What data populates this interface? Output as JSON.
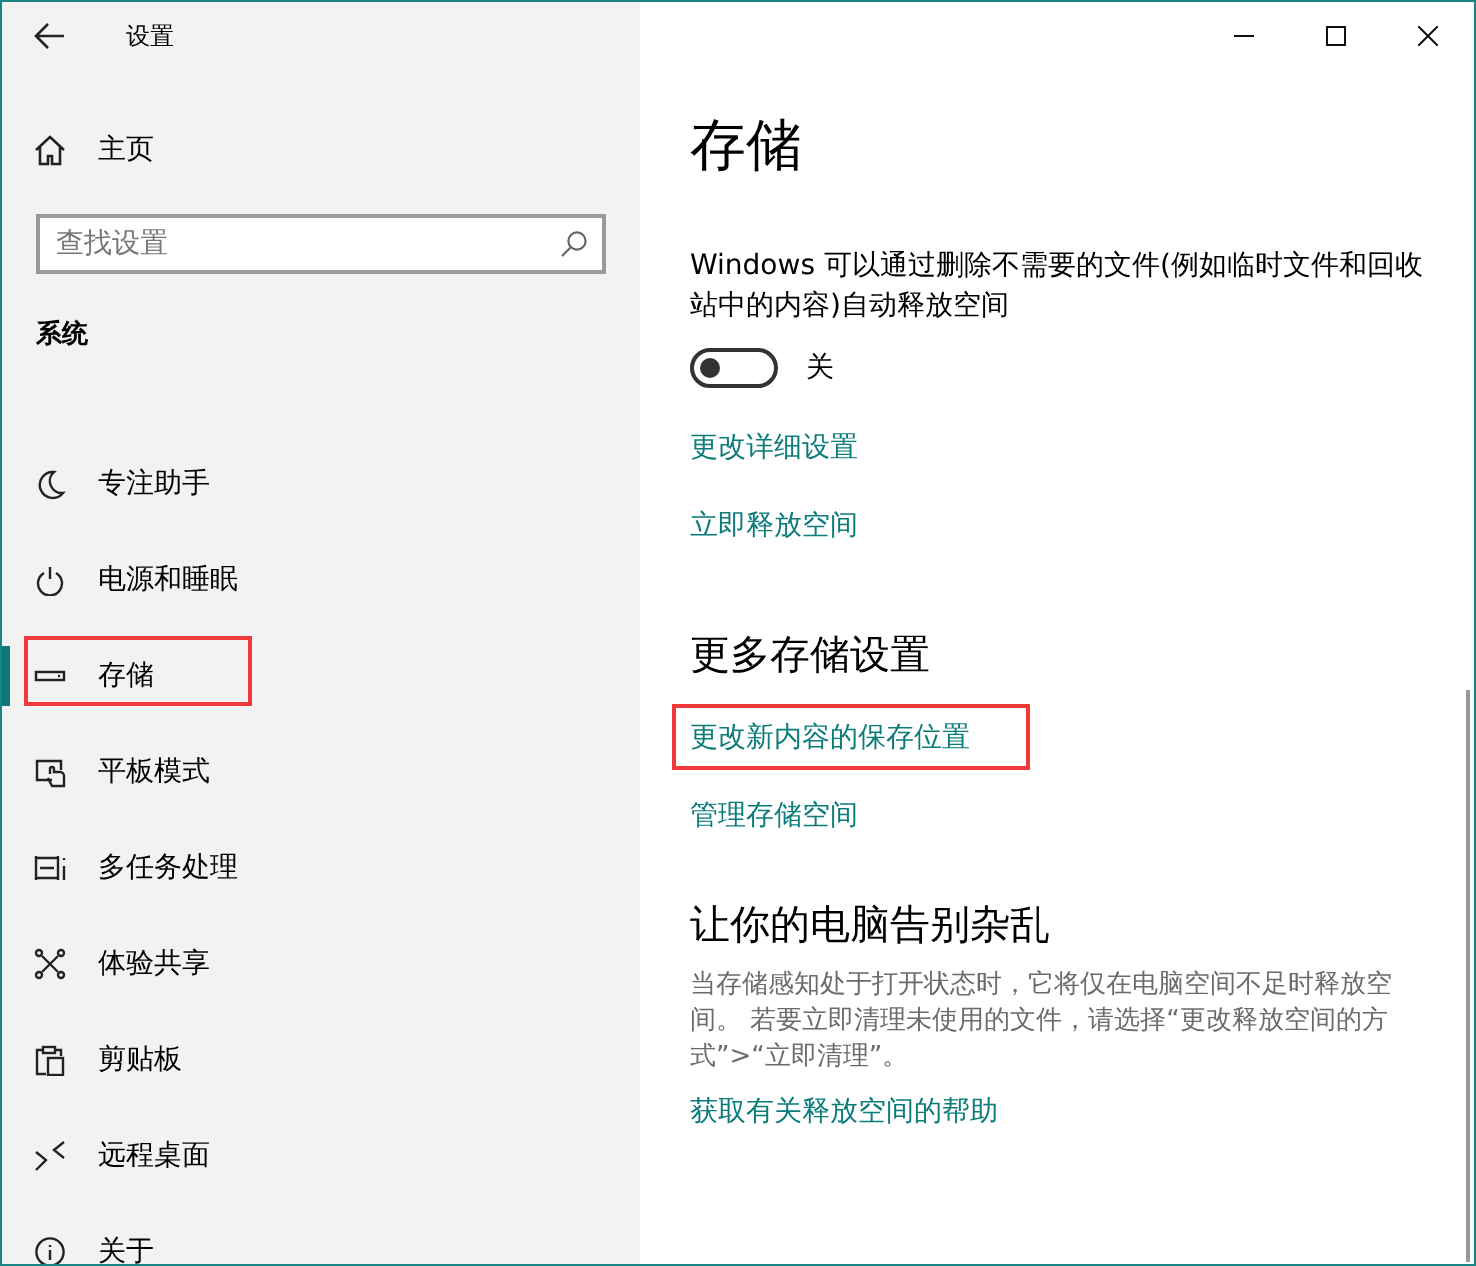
{
  "window": {
    "title": "设置"
  },
  "sidebar": {
    "home": "主页",
    "search": {
      "placeholder": "查找设置"
    },
    "section": "系统",
    "items": [
      {
        "label": "专注助手",
        "selected": false,
        "highlighted": false
      },
      {
        "label": "电源和睡眠",
        "selected": false,
        "highlighted": false
      },
      {
        "label": "存储",
        "selected": true,
        "highlighted": true
      },
      {
        "label": "平板模式",
        "selected": false,
        "highlighted": false
      },
      {
        "label": "多任务处理",
        "selected": false,
        "highlighted": false
      },
      {
        "label": "体验共享",
        "selected": false,
        "highlighted": false
      },
      {
        "label": "剪贴板",
        "selected": false,
        "highlighted": false
      },
      {
        "label": "远程桌面",
        "selected": false,
        "highlighted": false
      },
      {
        "label": "关于",
        "selected": false,
        "highlighted": false
      }
    ]
  },
  "content": {
    "title": "存储",
    "storage_sense": {
      "description": "Windows 可以通过删除不需要的文件(例如临时文件和回收站中的内容)自动释放空间",
      "toggle": {
        "on": false,
        "label": "关"
      },
      "links": [
        "更改详细设置",
        "立即释放空间"
      ]
    },
    "more_settings": {
      "heading": "更多存储设置",
      "links": [
        {
          "text": "更改新内容的保存位置",
          "highlighted": true
        },
        {
          "text": "管理存储空间",
          "highlighted": false
        }
      ]
    },
    "declutter": {
      "heading": "让你的电脑告别杂乱",
      "description": "当存储感知处于打开状态时，它将仅在电脑空间不足时释放空间。 若要立即清理未使用的文件，请选择“更改释放空间的方式”>“立即清理”。",
      "link": "获取有关释放空间的帮助"
    }
  }
}
